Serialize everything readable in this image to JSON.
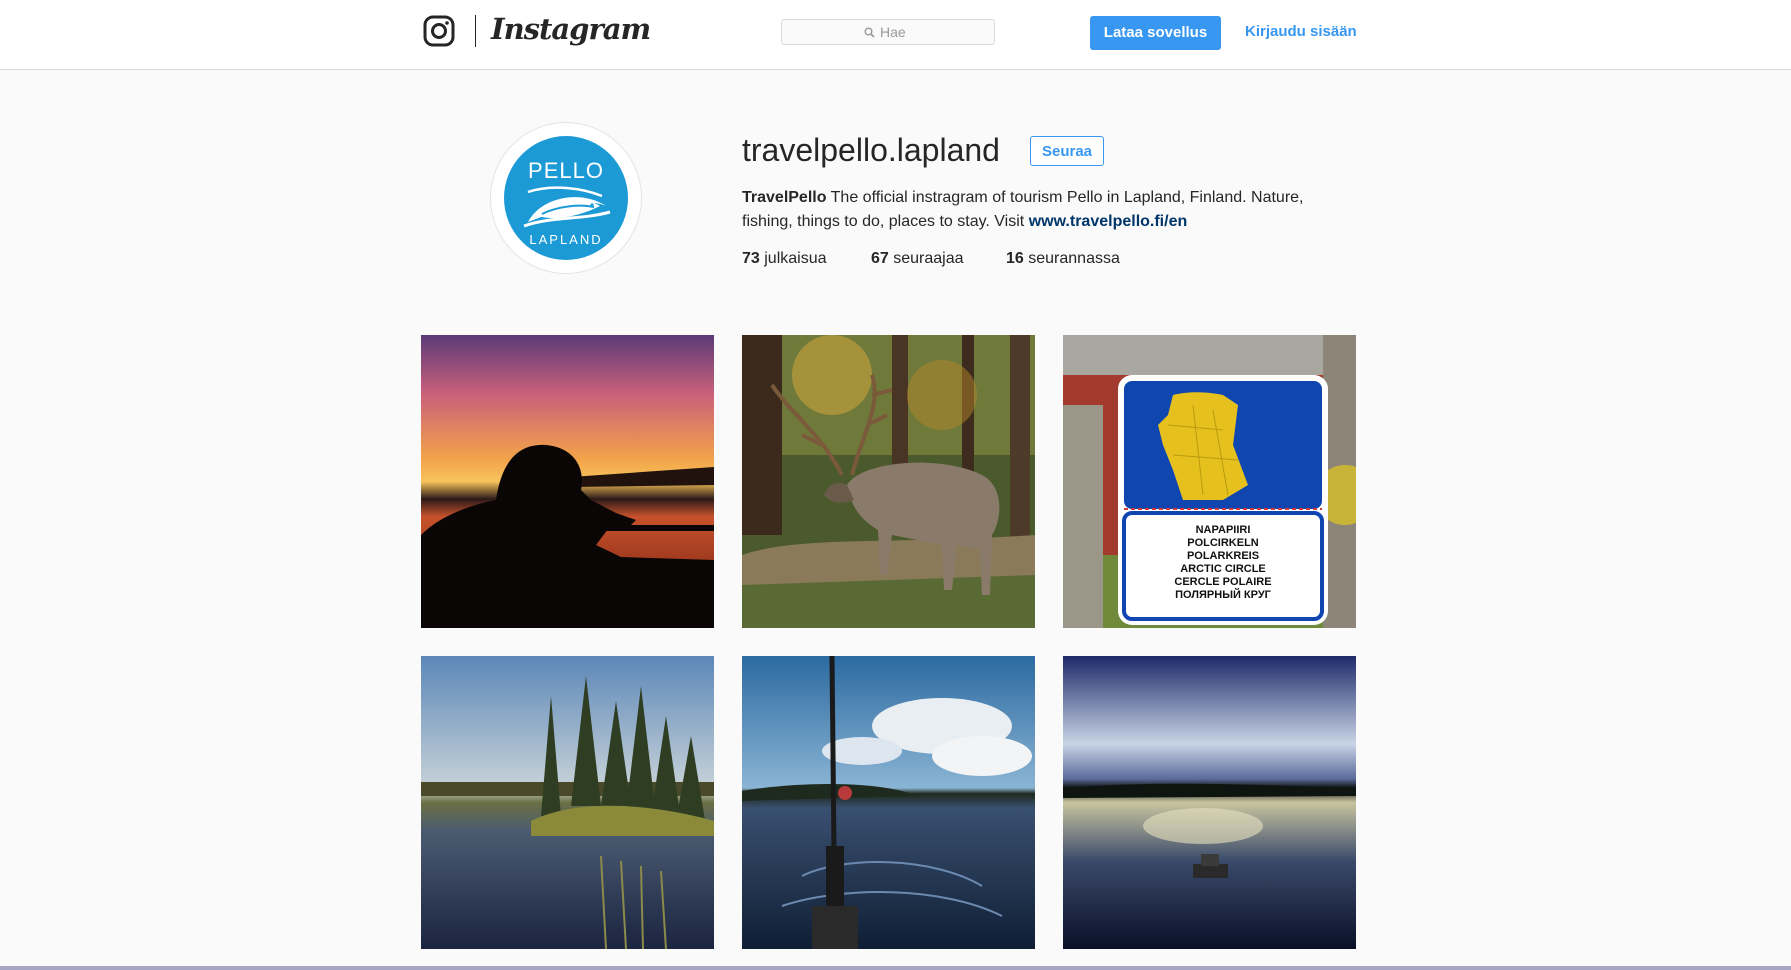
{
  "header": {
    "wordmark": "Instagram",
    "search_placeholder": "Hae",
    "download_button": "Lataa sovellus",
    "login_link": "Kirjaudu sisään"
  },
  "profile": {
    "avatar_text_top": "PELLO",
    "avatar_text_bottom": "LAPLAND",
    "username": "travelpello.lapland",
    "follow_button": "Seuraa",
    "bio_name": "TravelPello",
    "bio_text": "The official instragram of tourism Pello in Lapland, Finland. Nature, fishing, things to do, places to stay. Visit",
    "bio_link": "www.travelpello.fi/en",
    "stats": {
      "posts_count": "73",
      "posts_label": "julkaisua",
      "followers_count": "67",
      "followers_label": "seuraajaa",
      "following_count": "16",
      "following_label": "seurannassa"
    }
  },
  "posts": {
    "sign_lines": [
      "NAPAPIIRI",
      "POLCIRKELN",
      "POLARKREIS",
      "ARCTIC CIRCLE",
      "CERCLE POLAIRE",
      "ПОЛЯРНЫЙ КРУГ"
    ]
  },
  "colors": {
    "accent": "#3897f0",
    "link": "#003569",
    "avatar_blue": "#1b9ad6"
  }
}
